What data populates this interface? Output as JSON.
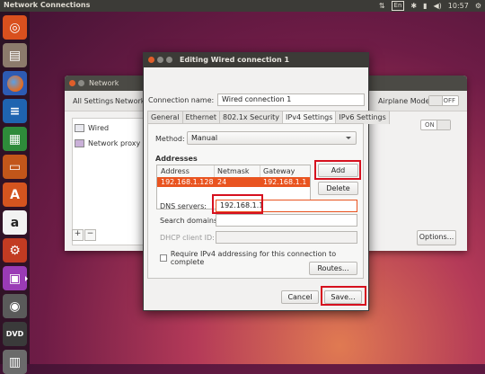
{
  "topbar": {
    "title": "Network Connections",
    "lang": "En",
    "clock": "10:57"
  },
  "network_window": {
    "title": "Network",
    "all_settings": "All Settings",
    "breadcrumb": "Network",
    "airplane_mode": "Airplane Mode",
    "airplane_state": "OFF",
    "wired_state": "ON",
    "sidebar": [
      "Wired",
      "Network proxy"
    ],
    "options_button": "Options..."
  },
  "dialog": {
    "title": "Editing Wired connection 1",
    "connection_name_label": "Connection name:",
    "connection_name_value": "Wired connection 1",
    "tabs": [
      "General",
      "Ethernet",
      "802.1x Security",
      "IPv4 Settings",
      "IPv6 Settings"
    ],
    "active_tab": "IPv4 Settings",
    "method_label": "Method:",
    "method_value": "Manual",
    "addresses_label": "Addresses",
    "columns": [
      "Address",
      "Netmask",
      "Gateway"
    ],
    "rows": [
      {
        "address": "192.168.1.128",
        "netmask": "24",
        "gateway": "192.168.1.1"
      }
    ],
    "add_button": "Add",
    "delete_button": "Delete",
    "dns_label": "DNS servers:",
    "dns_value": "192.168.1.1",
    "search_domains_label": "Search domains:",
    "search_domains_value": "",
    "dhcp_client_id_label": "DHCP client ID:",
    "dhcp_client_id_value": "",
    "require_ipv4_label": "Require IPv4 addressing for this connection to complete",
    "routes_button": "Routes...",
    "cancel_button": "Cancel",
    "save_button": "Save..."
  },
  "colors": {
    "accent": "#e95420",
    "highlight": "#d6101e",
    "titlebar": "#3c3b37"
  },
  "launcher_icons": [
    "ubuntu-logo-icon",
    "files-icon",
    "firefox-icon",
    "writer-icon",
    "calc-icon",
    "impress-icon",
    "software-center-icon",
    "amazon-icon",
    "system-settings-icon",
    "network-connections-icon",
    "disk-icon",
    "dvd-icon",
    "trash-icon"
  ]
}
